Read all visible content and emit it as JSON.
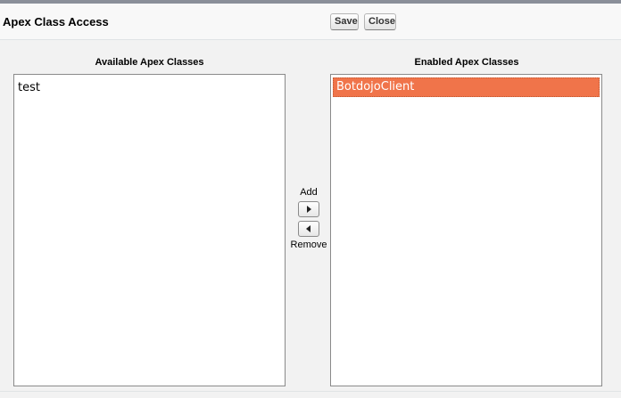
{
  "header": {
    "title": "Apex Class Access",
    "save_label": "Save",
    "close_label": "Close"
  },
  "available": {
    "label": "Available Apex Classes",
    "items": [
      "test"
    ]
  },
  "enabled": {
    "label": "Enabled Apex Classes",
    "items": [
      "BotdojoClient"
    ],
    "selected_item": "BotdojoClient"
  },
  "controls": {
    "add_label": "Add",
    "remove_label": "Remove",
    "add_icon": "triangle-right-icon",
    "remove_icon": "triangle-left-icon"
  },
  "colors": {
    "selection": "#f0744a",
    "topbar": "#8a8f99"
  }
}
